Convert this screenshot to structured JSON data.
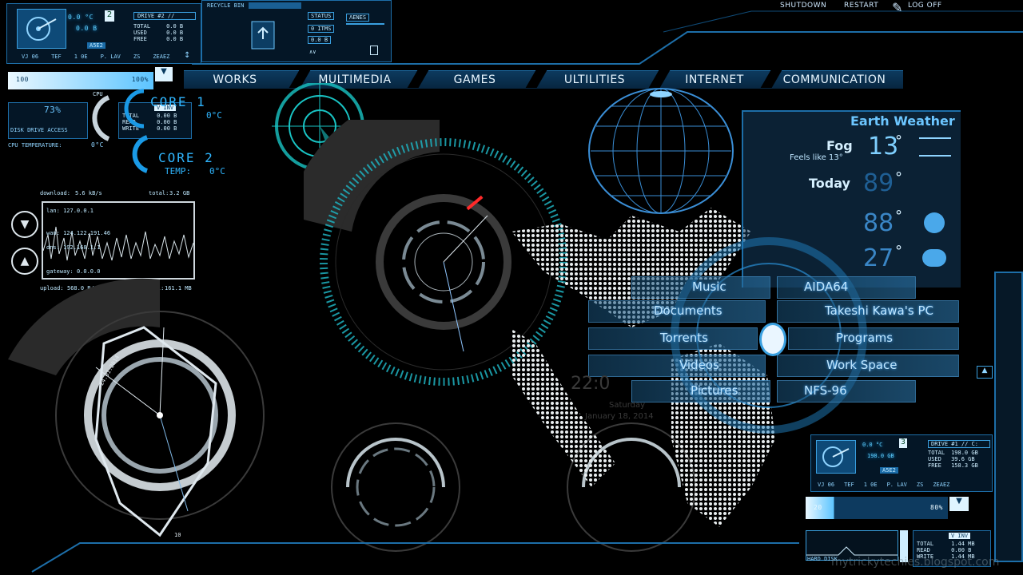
{
  "system": {
    "shutdown": "SHUTDOWN",
    "restart": "RESTART",
    "logoff": "LOG OFF"
  },
  "nav": [
    "WORKS",
    "MULTIMEDIA",
    "GAMES",
    "ULTILITIES",
    "INTERNET",
    "COMMUNICATION"
  ],
  "drive2": {
    "title": "DRIVE #2 //",
    "temp": "0.0 °C",
    "size": "0.0 B",
    "total_label": "TOTAL",
    "total": "0.0 B",
    "used_label": "USED",
    "used": "0.0 B",
    "free_label": "FREE",
    "free": "0.0 B",
    "tabs": [
      "VJ 06",
      "TEF",
      "1 0E",
      "P. LAV",
      "ZS",
      "ZEAEZ"
    ],
    "smart": "A5E2"
  },
  "recycle": {
    "status_label": "STATUS",
    "items": "0 ITMS",
    "size": "0.0 B",
    "empty_label": "EMPTY",
    "recycle_label": "RECYCLE BIN",
    "arrows": "∧∨",
    "menu_label": "ΛΕΝΕS"
  },
  "usage_bar": {
    "left": "100",
    "right": "100%"
  },
  "cpu": {
    "core1_label": "CORE 1",
    "core1_temp": "0°C",
    "core2_label": "CORE 2",
    "core2_temp_label": "TEMP:",
    "core2_temp": "0°C",
    "load": "73%",
    "cpu_label": "CPU",
    "cpu_temp_label": "CPU TEMPERATURE:",
    "cpu_temp": "0°C",
    "disk_access": "DISK DRIVE ACCESS",
    "total_label": "TOTAL",
    "total": "0.00 B",
    "read_label": "READ",
    "read": "0.00 B",
    "write_label": "WRITE",
    "write": "0.00 B",
    "mode": "V INV"
  },
  "network": {
    "download_label": "download:",
    "download": "5.6 kB/s",
    "total_dl_label": "total:",
    "total_dl": "3.2 GB",
    "lan_label": "lan:",
    "lan": "127.0.0.1",
    "wan_label": "wan:",
    "wan": "124.122.191.46",
    "dns_label": "dns:",
    "dns": "192.168.1.1",
    "gateway_label": "gateway:",
    "gateway": "0.0.0.0",
    "upload_label": "upload:",
    "upload": "568.0 B/s",
    "total_ul_label": "total:",
    "total_ul": "161.1 MB"
  },
  "clock_widget": {
    "date": "24.01.2014",
    "hour": "10"
  },
  "datetime": {
    "time": "22:0",
    "day": "Saturday",
    "date": "January 18, 2014"
  },
  "weather": {
    "title": "Earth Weather",
    "condition": "Fog",
    "now_temp": "13",
    "deg": "°",
    "feels": "Feels like 13°",
    "today": "Today",
    "today_temp": "89",
    "tomorrow_temp": "88",
    "day3_temp": "27"
  },
  "launcher": {
    "left": [
      "Music",
      "Documents",
      "Torrents",
      "Videos",
      "Pictures"
    ],
    "right": [
      "AIDA64",
      "Takeshi Kawa's PC",
      "Programs",
      "Work Space",
      "NFS-96"
    ]
  },
  "drive1": {
    "title": "DRIVE #1 // C:",
    "temp": "0.0 °C",
    "size": "198.0 GB",
    "total_label": "TOTAL",
    "total": "198.0 GB",
    "used_label": "USED",
    "used": "39.6 GB",
    "free_label": "FREE",
    "free": "158.3 GB",
    "tabs": [
      "VJ 06",
      "TEF",
      "1 0E",
      "P. LAV",
      "ZS",
      "ZEAEZ"
    ],
    "smart": "A5E2",
    "usage_left": "20",
    "usage_right": "80%"
  },
  "disk_small": {
    "mode": "V INV",
    "total_label": "TOTAL",
    "total": "1.44 MB",
    "read_label": "READ",
    "read": "0.00 B",
    "write_label": "WRITE",
    "write": "1.44 MB",
    "label": "HARD DISK"
  },
  "watermark": "mytrickytechies.blogspot.com",
  "colors": {
    "accent": "#39c4ff",
    "panel": "#0b3354",
    "border": "#1d6ea8",
    "cursor": "#ff2a2a"
  }
}
